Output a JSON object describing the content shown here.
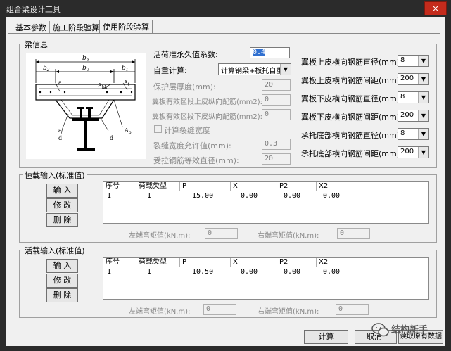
{
  "window": {
    "title": "组合梁设计工具",
    "close": "×"
  },
  "tabs": [
    "基本参数",
    "施工阶段验算",
    "使用阶段验算"
  ],
  "beam_info": {
    "group_title": "梁信息",
    "diagram_labels": {
      "be": "b",
      "be_sub": "e",
      "b2": "b",
      "b2_sub": "2",
      "b0": "b",
      "b0_sub": "0",
      "b1": "b",
      "b1_sub": "1",
      "a": "a",
      "abh": "A",
      "abh_sub": "bh",
      "at": "A",
      "at_sub": "t",
      "ab": "A",
      "ab_sub": "b",
      "d_left": "d",
      "d_right": "d",
      "a_left": "a"
    },
    "live_factor": {
      "label": "活荷准永久值系数:",
      "value": "0.4"
    },
    "self_weight": {
      "label": "自重计算:",
      "value": "计算钢梁+板托自重"
    },
    "cover": {
      "label": "保护层厚度(mm):",
      "value": "20"
    },
    "top_rebar": {
      "label": "翼板有效区段上皮纵向配筋(mm2):",
      "value": "0"
    },
    "bottom_rebar": {
      "label": "翼板有效区段下皮纵向配筋(mm2):",
      "value": "0"
    },
    "crack_calc": {
      "label": "计算裂缝宽度"
    },
    "crack_limit": {
      "label": "裂缝宽度允许值(mm):",
      "value": "0.3"
    },
    "rebar_dia": {
      "label": "受拉钢筋等效直径(mm):",
      "value": "20"
    },
    "right_fields": [
      {
        "label": "翼板上皮横向钢筋直径(mm):",
        "value": "8"
      },
      {
        "label": "翼板上皮横向钢筋间距(mm):",
        "value": "200"
      },
      {
        "label": "翼板下皮横向钢筋直径(mm):",
        "value": "8"
      },
      {
        "label": "翼板下皮横向钢筋间距(mm):",
        "value": "200"
      },
      {
        "label": "承托底部横向钢筋直径(mm):",
        "value": "8"
      },
      {
        "label": "承托底部横向钢筋间距(mm):",
        "value": "200"
      }
    ]
  },
  "dead_load": {
    "group_title": "恒载输入(标准值)",
    "buttons": [
      "输 入",
      "修 改",
      "删 除"
    ],
    "headers": [
      "序号",
      "荷载类型",
      "P",
      "X",
      "P2",
      "X2"
    ],
    "rows": [
      [
        "1",
        "1",
        "15.00",
        "0.00",
        "0.00",
        "0.00"
      ]
    ],
    "left_moment": {
      "label": "左端弯矩值(kN.m):",
      "value": "0"
    },
    "right_moment": {
      "label": "右端弯矩值(kN.m):",
      "value": "0"
    }
  },
  "live_load": {
    "group_title": "活载输入(标准值)",
    "buttons": [
      "输 入",
      "修 改",
      "删 除"
    ],
    "headers": [
      "序号",
      "荷载类型",
      "P",
      "X",
      "P2",
      "X2"
    ],
    "rows": [
      [
        "1",
        "1",
        "10.50",
        "0.00",
        "0.00",
        "0.00"
      ]
    ],
    "left_moment": {
      "label": "左端弯矩值(kN.m):",
      "value": "0"
    },
    "right_moment": {
      "label": "右端弯矩值(kN.m):",
      "value": "0"
    }
  },
  "footer": {
    "calc": "计算",
    "cancel": "取消",
    "watermark_name": "结构新手",
    "read_data": "读取原有数据"
  }
}
